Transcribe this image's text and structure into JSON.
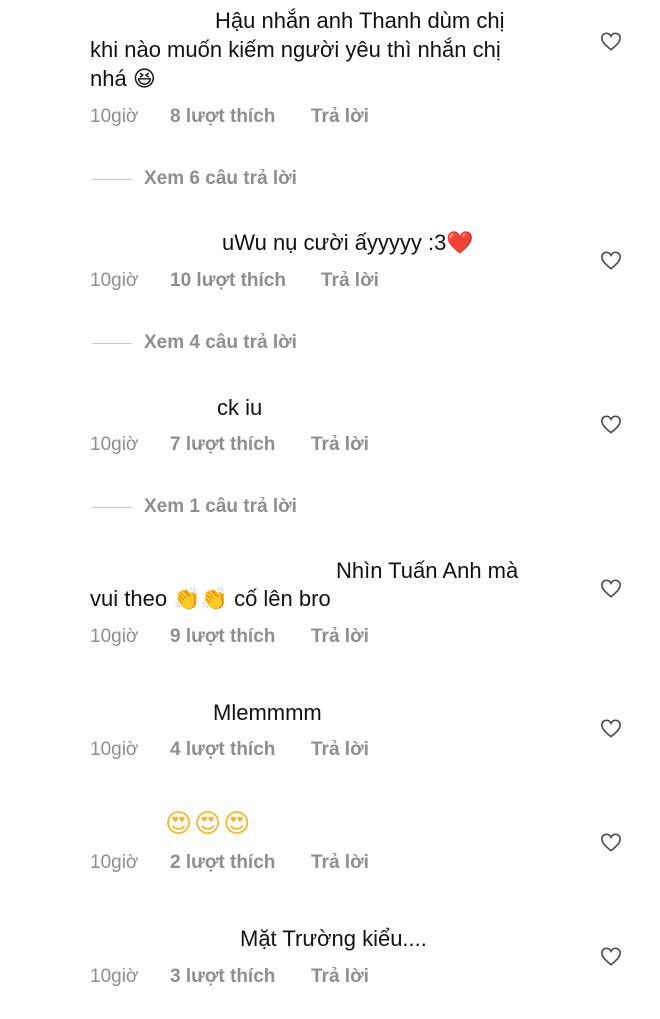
{
  "comments": [
    {
      "lines": [
        "Hậu nhắn anh Thanh dùm chị",
        "khi nào muốn kiếm người yêu thì nhắn chị",
        "nhá 😆"
      ],
      "time": "10giờ",
      "likes": "8 lượt thích",
      "reply": "Trả lời",
      "view_replies": "Xem 6 câu trả lời"
    },
    {
      "lines": [
        "uWu nụ cười ấyyyyy :3❤️"
      ],
      "time": "10giờ",
      "likes": "10 lượt thích",
      "reply": "Trả lời",
      "view_replies": "Xem 4 câu trả lời"
    },
    {
      "lines": [
        "ck iu"
      ],
      "time": "10giờ",
      "likes": "7 lượt thích",
      "reply": "Trả lời",
      "view_replies": "Xem 1 câu trả lời"
    },
    {
      "lines": [
        "Nhìn Tuấn Anh mà",
        "vui theo 👏👏 cố lên bro"
      ],
      "time": "10giờ",
      "likes": "9 lượt thích",
      "reply": "Trả lời"
    },
    {
      "lines": [
        "Mlemmmm"
      ],
      "time": "10giờ",
      "likes": "4 lượt thích",
      "reply": "Trả lời"
    },
    {
      "lines": [
        "😍😍😍"
      ],
      "time": "10giờ",
      "likes": "2 lượt thích",
      "reply": "Trả lời"
    },
    {
      "lines": [
        "Mặt Trường kiểu...."
      ],
      "time": "10giờ",
      "likes": "3 lượt thích",
      "reply": "Trả lời"
    }
  ],
  "icons": {
    "like": "heart-outline-icon"
  }
}
